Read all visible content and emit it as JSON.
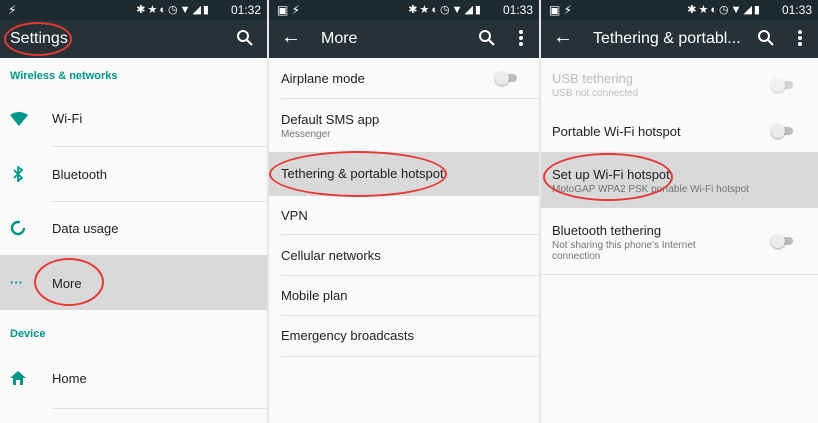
{
  "status": {
    "panel1_time": "01:32",
    "panel2_time": "01:33",
    "panel3_time": "01:33"
  },
  "panel1": {
    "title": "Settings",
    "section_wireless": "Wireless & networks",
    "items": [
      {
        "label": "Wi-Fi"
      },
      {
        "label": "Bluetooth"
      },
      {
        "label": "Data usage"
      },
      {
        "label": "More"
      }
    ],
    "section_device": "Device",
    "device_items": [
      {
        "label": "Home"
      }
    ]
  },
  "panel2": {
    "title": "More",
    "items": [
      {
        "label": "Airplane mode"
      },
      {
        "label": "Default SMS app",
        "sub": "Messenger"
      },
      {
        "label": "Tethering & portable hotspot"
      },
      {
        "label": "VPN"
      },
      {
        "label": "Cellular networks"
      },
      {
        "label": "Mobile plan"
      },
      {
        "label": "Emergency broadcasts"
      }
    ]
  },
  "panel3": {
    "title": "Tethering & portabl...",
    "items": [
      {
        "label": "USB tethering",
        "sub": "USB not connected"
      },
      {
        "label": "Portable Wi-Fi hotspot"
      },
      {
        "label": "Set up Wi-Fi hotspot",
        "sub": "MotoGAP WPA2 PSK portable Wi-Fi hotspot"
      },
      {
        "label": "Bluetooth tethering",
        "sub": "Not sharing this phone's Internet connection"
      }
    ]
  },
  "colors": {
    "toolbar": "#263238",
    "statusbar": "#1e2a31",
    "accent": "#009688",
    "annotation": "#e53935",
    "highlight": "#d9d9d9"
  }
}
